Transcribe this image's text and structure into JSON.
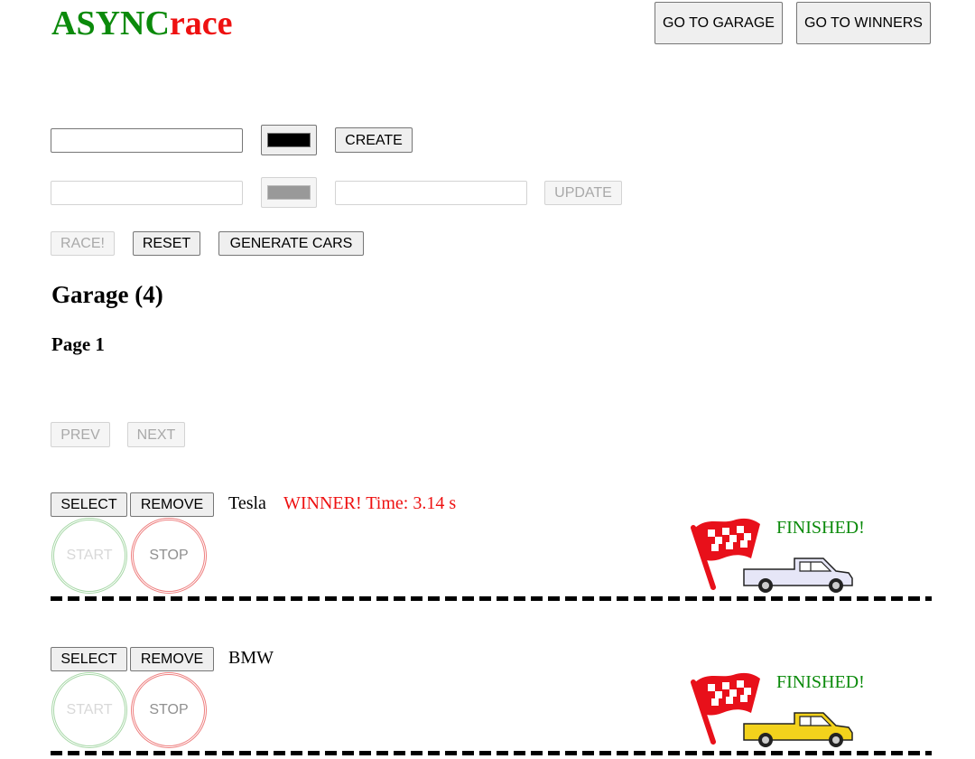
{
  "header": {
    "logo_part1": "ASYNC",
    "logo_part2": "race",
    "garage_button": "GO TO GARAGE",
    "winners_button": "GO TO WINNERS"
  },
  "create_form": {
    "name_value": "",
    "color_value": "#000000",
    "button": "CREATE"
  },
  "update_form": {
    "name_value": "",
    "color_value": "#999999",
    "extra_value": "",
    "button": "UPDATE"
  },
  "controls": {
    "race": "RACE!",
    "reset": "RESET",
    "generate": "GENERATE CARS"
  },
  "garage": {
    "title": "Garage (4)",
    "page": "Page 1",
    "prev": "PREV",
    "next": "NEXT"
  },
  "cars": [
    {
      "select": "SELECT",
      "remove": "REMOVE",
      "name": "Tesla",
      "winner_text": "WINNER! Time: 3.14 s",
      "start": "START",
      "stop": "STOP",
      "status": "FINISHED!",
      "color": "#e6e6f7",
      "icon": "pickup-truck-icon"
    },
    {
      "select": "SELECT",
      "remove": "REMOVE",
      "name": "BMW",
      "winner_text": "",
      "start": "START",
      "stop": "STOP",
      "status": "FINISHED!",
      "color": "#f3d21c",
      "icon": "pickup-truck-icon"
    }
  ],
  "colors": {
    "logo_green": "#0b8a0b",
    "logo_red": "#ee1111",
    "flag_red": "#e8101a",
    "finished_green": "#0b8a0b"
  }
}
